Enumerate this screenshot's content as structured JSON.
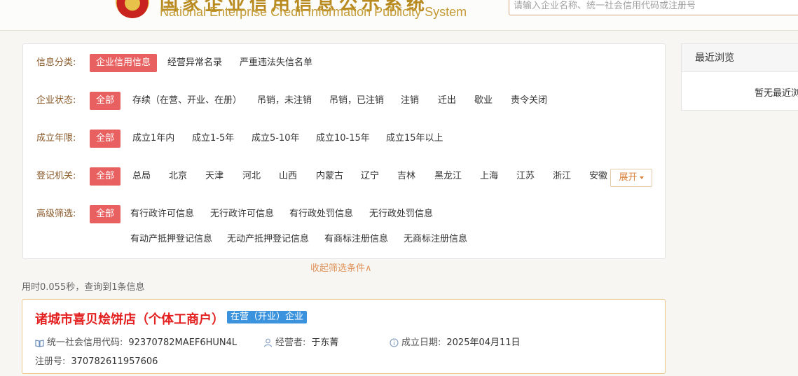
{
  "header": {
    "title_cn": "国家企业信用信息公示系统",
    "title_en": "National Enterprise Credit Information Publicity System",
    "search_placeholder": "请输入企业名称、统一社会信用代码或注册号"
  },
  "filters": {
    "category": {
      "label": "信息分类:",
      "options": [
        "企业信用信息",
        "经营异常名录",
        "严重违法失信名单"
      ]
    },
    "status": {
      "label": "企业状态:",
      "options": [
        "全部",
        "存续（在营、开业、在册）",
        "吊销，未注销",
        "吊销，已注销",
        "注销",
        "迁出",
        "歇业",
        "责令关闭"
      ]
    },
    "years": {
      "label": "成立年限:",
      "options": [
        "全部",
        "成立1年内",
        "成立1-5年",
        "成立5-10年",
        "成立10-15年",
        "成立15年以上"
      ]
    },
    "authority": {
      "label": "登记机关:",
      "options": [
        "全部",
        "总局",
        "北京",
        "天津",
        "河北",
        "山西",
        "内蒙古",
        "辽宁",
        "吉林",
        "黑龙江",
        "上海",
        "江苏",
        "浙江",
        "安徽"
      ],
      "expand_label": "展开"
    },
    "advanced": {
      "label": "高级筛选:",
      "options_row1": [
        "全部",
        "有行政许可信息",
        "无行政许可信息",
        "有行政处罚信息",
        "无行政处罚信息"
      ],
      "options_row2": [
        "有动产抵押登记信息",
        "无动产抵押登记信息",
        "有商标注册信息",
        "无商标注册信息"
      ]
    },
    "collapse_label": "收起筛选条件∧"
  },
  "result_stats": "用时0.055秒，查询到1条信息",
  "result": {
    "name": "诸城市喜贝烩饼店（个体工商户）",
    "status": "在营（开业）企业",
    "credit_code_label": "统一社会信用代码:",
    "credit_code": "92370782MAEF6HUN4L",
    "operator_label": "经营者:",
    "operator": "于东菁",
    "founded_label": "成立日期:",
    "founded": "2025年04月11日",
    "reg_no_label": "注册号:",
    "reg_no": "370782611957606"
  },
  "recent": {
    "title": "最近浏览",
    "empty": "暂无最近浏览"
  },
  "colors": {
    "active_tag": "#e86060",
    "label": "#8a5a2a",
    "accent": "#d9823b",
    "company_name": "#e41f1f",
    "status_badge": "#3b93de",
    "card_border": "#ecc78e"
  }
}
